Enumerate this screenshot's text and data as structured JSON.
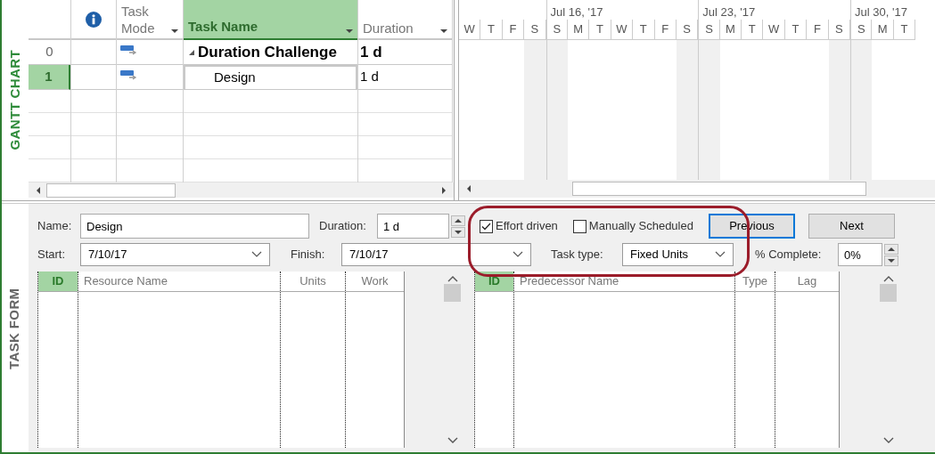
{
  "gantt": {
    "side_label": "GANTT CHART",
    "columns": [
      {
        "kind": "id",
        "selected": false
      },
      {
        "kind": "info",
        "selected": false
      },
      {
        "kind": "mode",
        "label": "Task Mode",
        "selected": false
      },
      {
        "kind": "name",
        "label": "Task Name",
        "selected": true
      },
      {
        "kind": "duration",
        "label": "Duration",
        "selected": false
      }
    ],
    "rows": [
      {
        "id": "0",
        "name": "Duration Challenge",
        "duration": "1 d",
        "summary": true,
        "expanded": true,
        "selected": false
      },
      {
        "id": "1",
        "name": "Design",
        "duration": "1 d",
        "summary": false,
        "selected": true
      }
    ],
    "days": [
      {
        "label": "W",
        "weekend": false
      },
      {
        "label": "T",
        "weekend": false
      },
      {
        "label": "F",
        "weekend": false
      },
      {
        "label": "S",
        "weekend": true
      },
      {
        "label": "S",
        "weekend": true,
        "week": "Jul 16, '17"
      },
      {
        "label": "M",
        "weekend": false
      },
      {
        "label": "T",
        "weekend": false
      },
      {
        "label": "W",
        "weekend": false
      },
      {
        "label": "T",
        "weekend": false
      },
      {
        "label": "F",
        "weekend": false
      },
      {
        "label": "S",
        "weekend": true
      },
      {
        "label": "S",
        "weekend": true,
        "week": "Jul 23, '17"
      },
      {
        "label": "M",
        "weekend": false
      },
      {
        "label": "T",
        "weekend": false
      },
      {
        "label": "W",
        "weekend": false
      },
      {
        "label": "T",
        "weekend": false
      },
      {
        "label": "F",
        "weekend": false
      },
      {
        "label": "S",
        "weekend": true
      },
      {
        "label": "S",
        "weekend": true,
        "week": "Jul 30, '17"
      },
      {
        "label": "M",
        "weekend": false
      },
      {
        "label": "T",
        "weekend": false
      }
    ]
  },
  "task_form": {
    "side_label": "TASK FORM",
    "name": {
      "label": "Name:",
      "value": "Design"
    },
    "duration": {
      "label": "Duration:",
      "value": "1 d"
    },
    "effort_driven": {
      "label": "Effort driven",
      "checked": true
    },
    "manually_scheduled": {
      "label": "Manually Scheduled",
      "checked": false
    },
    "buttons": [
      {
        "label": "Previous",
        "focused": true
      },
      {
        "label": "Next",
        "focused": false
      }
    ],
    "start": {
      "label": "Start:",
      "value": "7/10/17"
    },
    "finish": {
      "label": "Finish:",
      "value": "7/10/17"
    },
    "task_type": {
      "label": "Task type:",
      "value": "Fixed Units"
    },
    "percent_complete": {
      "label": "% Complete:",
      "value": "0%"
    },
    "resources": [
      {
        "label": "ID",
        "selected": true
      },
      {
        "label": "Resource Name",
        "selected": false
      },
      {
        "label": "Units",
        "selected": false
      },
      {
        "label": "Work",
        "selected": false
      }
    ],
    "predecessors": [
      {
        "label": "ID",
        "selected": true
      },
      {
        "label": "Predecessor Name",
        "selected": false
      },
      {
        "label": "Type",
        "selected": false
      },
      {
        "label": "Lag",
        "selected": false
      }
    ]
  }
}
